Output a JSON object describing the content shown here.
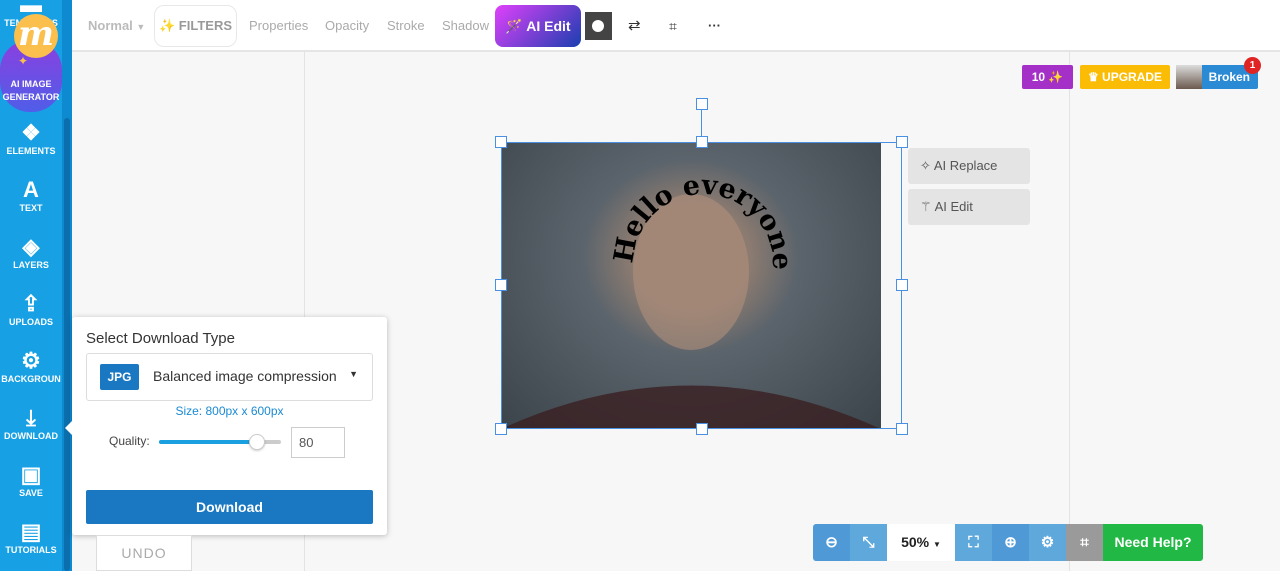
{
  "sidebar": {
    "items": [
      {
        "label": "TEMPLATES",
        "icon": "templates-icon"
      },
      {
        "label": "AI IMAGE GENERATOR",
        "icon": "m-logo-icon"
      },
      {
        "label": "ELEMENTS",
        "icon": "elements-icon"
      },
      {
        "label": "TEXT",
        "icon": "text-icon"
      },
      {
        "label": "LAYERS",
        "icon": "layers-icon"
      },
      {
        "label": "UPLOADS",
        "icon": "upload-icon"
      },
      {
        "label": "BACKGROUN",
        "icon": "gear-icon"
      },
      {
        "label": "DOWNLOAD",
        "icon": "download-icon"
      },
      {
        "label": "SAVE",
        "icon": "save-icon"
      },
      {
        "label": "TUTORIALS",
        "icon": "book-icon"
      }
    ]
  },
  "toolbar": {
    "blend": "Normal",
    "filters": "FILTERS",
    "properties": "Properties",
    "opacity": "Opacity",
    "stroke": "Stroke",
    "shadow": "Shadow",
    "ai_edit": "AI Edit"
  },
  "header": {
    "credits": "10 ✨",
    "upgrade": "UPGRADE",
    "user": "Broken",
    "notifications": "1"
  },
  "canvas": {
    "text": "Hello everyone",
    "ai_replace": "AI Replace",
    "ai_edit": "AI Edit"
  },
  "download": {
    "title": "Select Download Type",
    "format": "JPG",
    "type": "Balanced image compression",
    "size": "Size: 800px x 600px",
    "quality_label": "Quality:",
    "quality": 80,
    "quality_value": "80",
    "button": "Download"
  },
  "undo": "UNDO",
  "zoom": {
    "level": "50%",
    "help": "Need Help?"
  },
  "colors": {
    "sidebar": "#18a0e4",
    "primary": "#1a78c2",
    "help": "#22b845",
    "upgrade": "#fbbc05",
    "credits": "#a530c8"
  }
}
